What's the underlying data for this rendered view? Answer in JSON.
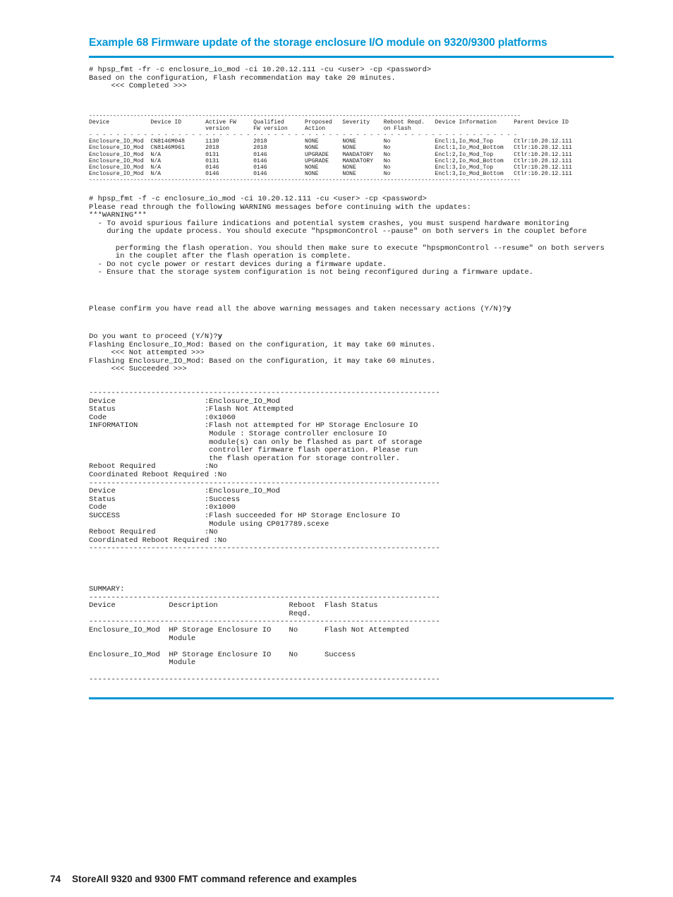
{
  "heading": {
    "title": "Example 68 Firmware update of the storage enclosure I/O module on 9320/9300 platforms",
    "rule_color": "#0096d6"
  },
  "console": {
    "command_recommendation": "# hpsp_fmt -fr -c enclosure_io_mod -ci 10.20.12.111 -cu <user> -cp <password>\nBased on the configuration, Flash recommendation may take 20 minutes.\n     <<< Completed >>>",
    "command_flash": "# hpsp_fmt -f -c enclosure_io_mod -ci 10.20.12.111 -cu <user> -cp <password>",
    "warning_intro": "Please read through the following WARNING messages before continuing with the updates:",
    "warning_banner": "***WARNING***",
    "warning_lines": [
      "  - To avoid spurious failure indications and potential system crashes, you must suspend hardware monitoring",
      "    during the update process. You should execute \"hpspmonControl --pause\" on both servers in the couplet before",
      "",
      "      performing the flash operation. You should then make sure to execute \"hpspmonControl --resume\" on both servers",
      "      in the couplet after the flash operation is complete.",
      "  - Do not cycle power or restart devices during a firmware update.",
      "  - Ensure that the storage system configuration is not being reconfigured during a firmware update."
    ],
    "confirm_prompt": "Please confirm you have read all the above warning messages and taken necessary actions (Y/N)?",
    "confirm_answer": "y",
    "proceed_prompt": "Do you want to proceed (Y/N)?",
    "proceed_answer": "y",
    "flash_lines": [
      "Flashing Enclosure_IO_Mod: Based on the configuration, it may take 60 minutes.",
      "     <<< Not attempted >>>",
      "Flashing Enclosure_IO_Mod: Based on the configuration, it may take 60 minutes.",
      "     <<< Succeeded >>>"
    ]
  },
  "fw_table": {
    "separator": "--------------------------------------------------------------------------------------------------------------------------",
    "dashed_separator": "- - - - - - - - - - - - - - - - - - - - - - - - - - - - - - - - - - - - - - - - - - - - - - - - - - - - - - - - - - - - -",
    "columns": [
      "Device",
      "Device ID",
      "Active FW\nversion",
      "Qualified\nFW version",
      "Proposed\nAction",
      "Severity",
      "Reboot Reqd.\non Flash",
      "Device Information",
      "Parent Device ID"
    ],
    "rows": [
      {
        "device": "Enclosure_IO_Mod",
        "device_id": "CN8146M048",
        "active_fw": "1130",
        "qualified_fw": "2018",
        "proposed_action": "NONE",
        "severity": "NONE",
        "reboot_reqd": "No",
        "device_info": "Encl:1,Io_Mod_Top",
        "parent_device_id": "Ctlr:10.20.12.111"
      },
      {
        "device": "Enclosure_IO_Mod",
        "device_id": "CN8146M961",
        "active_fw": "2018",
        "qualified_fw": "2018",
        "proposed_action": "NONE",
        "severity": "NONE",
        "reboot_reqd": "No",
        "device_info": "Encl:1,Io_Mod_Bottom",
        "parent_device_id": "Ctlr:10.20.12.111"
      },
      {
        "device": "Enclosure_IO_Mod",
        "device_id": "N/A",
        "active_fw": "0131",
        "qualified_fw": "0146",
        "proposed_action": "UPGRADE",
        "severity": "MANDATORY",
        "reboot_reqd": "No",
        "device_info": "Encl:2,Io_Mod_Top",
        "parent_device_id": "Ctlr:10.20.12.111"
      },
      {
        "device": "Enclosure_IO_Mod",
        "device_id": "N/A",
        "active_fw": "0131",
        "qualified_fw": "0146",
        "proposed_action": "UPGRADE",
        "severity": "MANDATORY",
        "reboot_reqd": "No",
        "device_info": "Encl:2,Io_Mod_Bottom",
        "parent_device_id": "Ctlr:10.20.12.111"
      },
      {
        "device": "Enclosure_IO_Mod",
        "device_id": "N/A",
        "active_fw": "0146",
        "qualified_fw": "0146",
        "proposed_action": "NONE",
        "severity": "NONE",
        "reboot_reqd": "No",
        "device_info": "Encl:3,Io_Mod_Top",
        "parent_device_id": "Ctlr:10.20.12.111"
      },
      {
        "device": "Enclosure_IO_Mod",
        "device_id": "N/A",
        "active_fw": "0146",
        "qualified_fw": "0146",
        "proposed_action": "NONE",
        "severity": "NONE",
        "reboot_reqd": "No",
        "device_info": "Encl:3,Io_Mod_Bottom",
        "parent_device_id": "Ctlr:10.20.12.111"
      }
    ]
  },
  "detail_results": {
    "separator": "-------------------------------------------------------------------------------",
    "blocks": [
      {
        "device": "Enclosure_IO_Mod",
        "status": "Flash Not Attempted",
        "code": "0x1060",
        "message_label": "INFORMATION",
        "message_lines": [
          "Flash not attempted for HP Storage Enclosure IO",
          "Module : Storage controller enclosure IO",
          "module(s) can only be flashed as part of storage",
          "controller firmware flash operation. Please run",
          "the flash operation for storage controller."
        ],
        "reboot_required": "No",
        "coordinated_reboot_required": "No"
      },
      {
        "device": "Enclosure_IO_Mod",
        "status": "Success",
        "code": "0x1000",
        "message_label": "SUCCESS",
        "message_lines": [
          "Flash succeeded for HP Storage Enclosure IO",
          "Module using CP017789.scexe"
        ],
        "reboot_required": "No",
        "coordinated_reboot_required": "No"
      }
    ],
    "labels": {
      "device": "Device",
      "status": "Status",
      "code": "Code",
      "reboot_required": "Reboot Required",
      "coordinated_reboot_required": "Coordinated Reboot Required"
    }
  },
  "summary": {
    "title": "SUMMARY:",
    "separator": "-------------------------------------------------------------------------------",
    "columns": [
      "Device",
      "Description",
      "Reboot\nReqd.",
      "Flash Status"
    ],
    "rows": [
      {
        "device": "Enclosure_IO_Mod",
        "description_line1": "HP Storage Enclosure IO",
        "description_line2": "Module",
        "reboot_reqd": "No",
        "flash_status": "Flash Not Attempted"
      },
      {
        "device": "Enclosure_IO_Mod",
        "description_line1": "HP Storage Enclosure IO",
        "description_line2": "Module",
        "reboot_reqd": "No",
        "flash_status": "Success"
      }
    ]
  },
  "footer": {
    "page_number": "74",
    "title": "StoreAll 9320 and 9300 FMT command reference and examples"
  }
}
